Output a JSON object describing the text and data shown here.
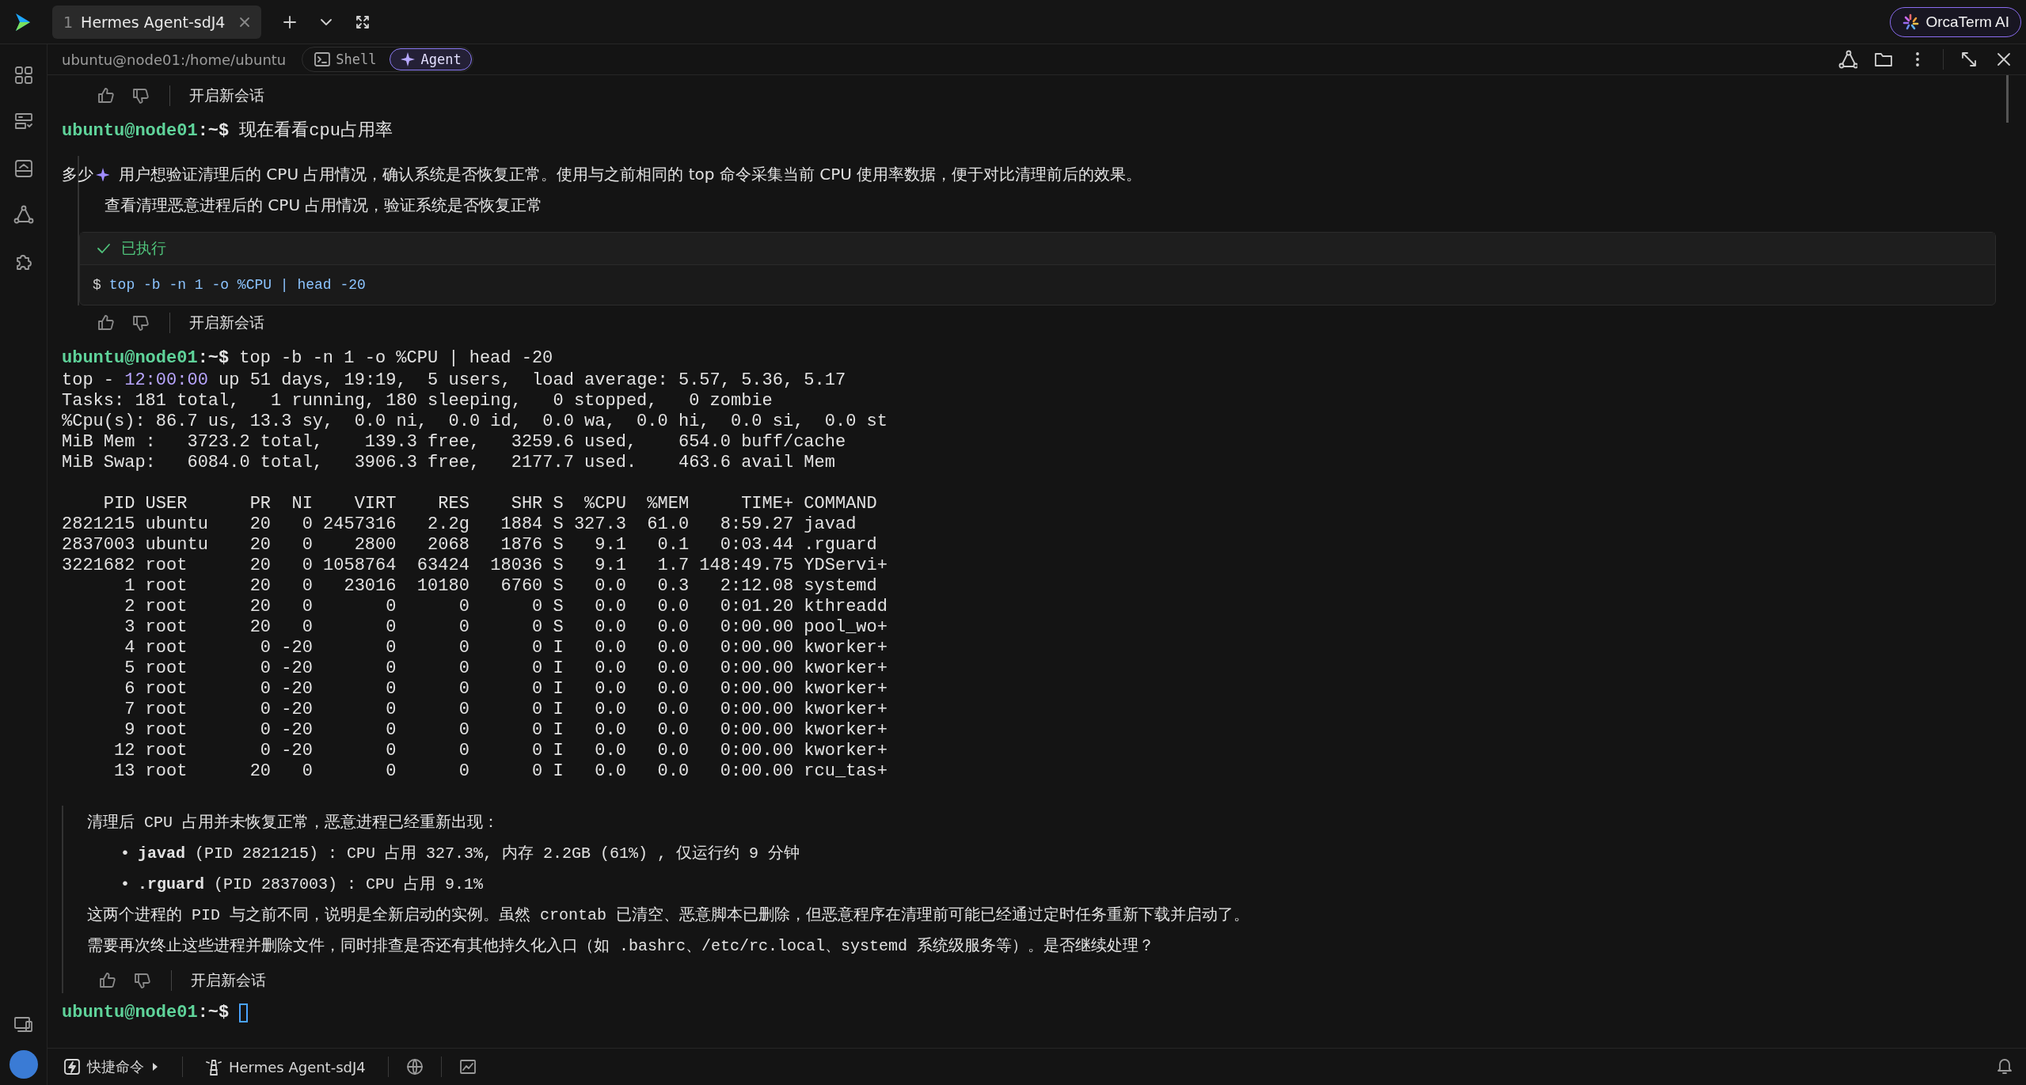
{
  "app": {
    "tabs": [
      {
        "number": "1",
        "title": "Hermes Agent-sdJ4",
        "selected": true
      }
    ],
    "ai_button": "OrcaTerm AI"
  },
  "session_bar": {
    "path": "ubuntu@node01:/home/ubuntu",
    "modes": [
      {
        "label": "Shell",
        "kind": "shell",
        "selected": false
      },
      {
        "label": "Agent",
        "kind": "agent",
        "selected": true
      }
    ]
  },
  "terminal": [
    {
      "kind": "feedback",
      "action": "开启新会话"
    },
    {
      "kind": "prompt",
      "user": "ubuntu@node01",
      "path": ":~$",
      "command": "现在看看cpu占用率"
    },
    {
      "kind": "agent",
      "label": "多少",
      "thought": "用户想验证清理后的 CPU 占用情况，确认系统是否恢复正常。使用与之前相同的 top 命令采集当前 CPU 使用率数据，便于对比清理前后的效果。",
      "summary": "查看清理恶意进程后的 CPU 占用情况，验证系统是否恢复正常",
      "status": "已执行",
      "dollar": "$",
      "command": "top -b -n 1 -o %CPU | head -20"
    },
    {
      "kind": "feedback",
      "action": "开启新会话"
    },
    {
      "kind": "prompt",
      "user": "ubuntu@node01",
      "path": ":~$",
      "command": "top -b -n 1 -o %CPU | head -20"
    },
    {
      "kind": "output",
      "uptime": {
        "prefix": "top - ",
        "time": "12:00:00",
        "rest": " up 51 days, 19:19,  5 users,  load average: 5.57, 5.36, 5.17"
      },
      "lines": [
        "Tasks: 181 total,   1 running, 180 sleeping,   0 stopped,   0 zombie",
        "%Cpu(s): 86.7 us, 13.3 sy,  0.0 ni,  0.0 id,  0.0 wa,  0.0 hi,  0.0 si,  0.0 st",
        "MiB Mem :   3723.2 total,    139.3 free,   3259.6 used,    654.0 buff/cache",
        "MiB Swap:   6084.0 total,   3906.3 free,   2177.7 used.    463.6 avail Mem"
      ],
      "table": [
        "    PID USER      PR  NI    VIRT    RES    SHR S  %CPU  %MEM     TIME+ COMMAND",
        "2821215 ubuntu    20   0 2457316   2.2g   1884 S 327.3  61.0   8:59.27 javad",
        "2837003 ubuntu    20   0    2800   2068   1876 S   9.1   0.1   0:03.44 .rguard",
        "3221682 root      20   0 1058764  63424  18036 S   9.1   1.7 148:49.75 YDServi+",
        "      1 root      20   0   23016  10180   6760 S   0.0   0.3   2:12.08 systemd",
        "      2 root      20   0       0      0      0 S   0.0   0.0   0:01.20 kthreadd",
        "      3 root      20   0       0      0      0 S   0.0   0.0   0:00.00 pool_wo+",
        "      4 root       0 -20       0      0      0 I   0.0   0.0   0:00.00 kworker+",
        "      5 root       0 -20       0      0      0 I   0.0   0.0   0:00.00 kworker+",
        "      6 root       0 -20       0      0      0 I   0.0   0.0   0:00.00 kworker+",
        "      7 root       0 -20       0      0      0 I   0.0   0.0   0:00.00 kworker+",
        "      9 root       0 -20       0      0      0 I   0.0   0.0   0:00.00 kworker+",
        "     12 root       0 -20       0      0      0 I   0.0   0.0   0:00.00 kworker+",
        "     13 root      20   0       0      0      0 I   0.0   0.0   0:00.00 rcu_tas+"
      ]
    },
    {
      "kind": "answer",
      "items": [
        {
          "kind": "paragraph",
          "text": "清理后 CPU 占用并未恢复正常，恶意进程已经重新出现："
        },
        {
          "kind": "bullet",
          "marker": "•",
          "text": "**javad** (PID 2821215) : CPU 占用 327.3%, 内存 2.2GB (61%) , 仅运行约 9 分钟"
        },
        {
          "kind": "bullet",
          "marker": "•",
          "text": "**.rguard** (PID 2837003) : CPU 占用 9.1%"
        },
        {
          "kind": "paragraph",
          "text": "这两个进程的 PID 与之前不同，说明是全新启动的实例。虽然 crontab 已清空、恶意脚本已删除，但恶意程序在清理前可能已经通过定时任务重新下载并启动了。"
        },
        {
          "kind": "paragraph",
          "text": "需要再次终止这些进程并删除文件，同时排查是否还有其他持久化入口（如 .bashrc、/etc/rc.local、systemd 系统级服务等）。是否继续处理？"
        }
      ]
    },
    {
      "kind": "feedback",
      "action": "开启新会话"
    },
    {
      "kind": "prompt",
      "user": "ubuntu@node01",
      "path": ":~$",
      "cursor": true
    }
  ],
  "footer": {
    "quick_commands": "快捷命令",
    "session": "Hermes Agent-sdJ4"
  }
}
